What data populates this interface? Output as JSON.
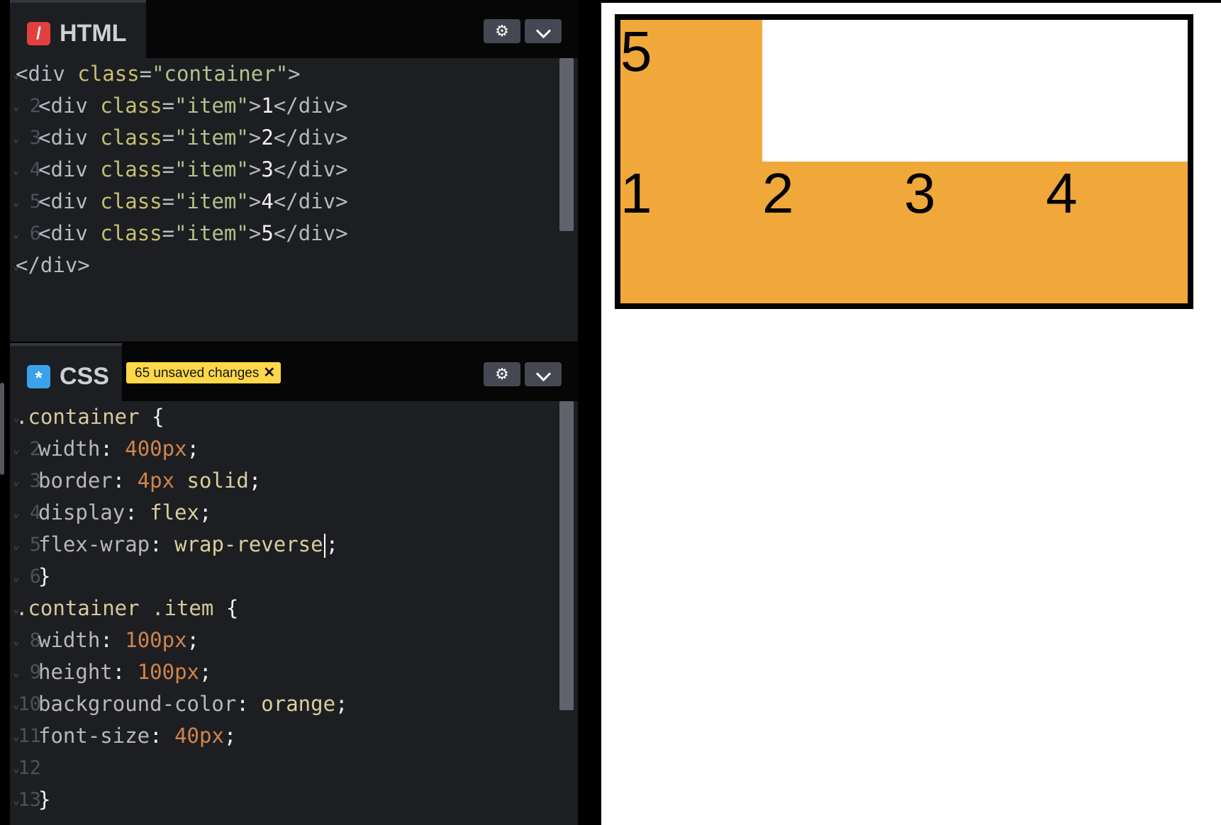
{
  "html_pane": {
    "title": "HTML",
    "icon": "slash-icon",
    "lines": [
      {
        "n": "",
        "parts": [
          [
            "tag",
            "<div "
          ],
          [
            "attr",
            "class"
          ],
          [
            "tag",
            "="
          ],
          [
            "str",
            "\"container\""
          ],
          [
            "tag",
            ">"
          ]
        ]
      },
      {
        "n": "2",
        "parts": [
          [
            "tag",
            "<div "
          ],
          [
            "attr",
            "class"
          ],
          [
            "tag",
            "="
          ],
          [
            "str",
            "\"item\""
          ],
          [
            "tag",
            ">"
          ],
          [
            "plain",
            "1"
          ],
          [
            "tag",
            "</div>"
          ]
        ]
      },
      {
        "n": "3",
        "parts": [
          [
            "tag",
            "<div "
          ],
          [
            "attr",
            "class"
          ],
          [
            "tag",
            "="
          ],
          [
            "str",
            "\"item\""
          ],
          [
            "tag",
            ">"
          ],
          [
            "plain",
            "2"
          ],
          [
            "tag",
            "</div>"
          ]
        ]
      },
      {
        "n": "4",
        "parts": [
          [
            "tag",
            "<div "
          ],
          [
            "attr",
            "class"
          ],
          [
            "tag",
            "="
          ],
          [
            "str",
            "\"item\""
          ],
          [
            "tag",
            ">"
          ],
          [
            "plain",
            "3"
          ],
          [
            "tag",
            "</div>"
          ]
        ]
      },
      {
        "n": "5",
        "parts": [
          [
            "tag",
            "<div "
          ],
          [
            "attr",
            "class"
          ],
          [
            "tag",
            "="
          ],
          [
            "str",
            "\"item\""
          ],
          [
            "tag",
            ">"
          ],
          [
            "plain",
            "4"
          ],
          [
            "tag",
            "</div>"
          ]
        ]
      },
      {
        "n": "6",
        "parts": [
          [
            "tag",
            "<div "
          ],
          [
            "attr",
            "class"
          ],
          [
            "tag",
            "="
          ],
          [
            "str",
            "\"item\""
          ],
          [
            "tag",
            ">"
          ],
          [
            "plain",
            "5"
          ],
          [
            "tag",
            "</div>"
          ]
        ]
      },
      {
        "n": "",
        "parts": [
          [
            "tag",
            "</div>"
          ]
        ]
      }
    ]
  },
  "css_pane": {
    "title": "CSS",
    "icon": "asterisk-icon",
    "unsaved_label": "65 unsaved changes",
    "lines": [
      {
        "n": "",
        "parts": [
          [
            "sel",
            ".container "
          ],
          [
            "plain",
            "{"
          ]
        ]
      },
      {
        "n": "2",
        "parts": [
          [
            "prop",
            "width"
          ],
          [
            "plain",
            ": "
          ],
          [
            "num",
            "400px"
          ],
          [
            "plain",
            ";"
          ]
        ]
      },
      {
        "n": "3",
        "parts": [
          [
            "prop",
            "border"
          ],
          [
            "plain",
            ": "
          ],
          [
            "num",
            "4px"
          ],
          [
            "kw",
            " solid"
          ],
          [
            "plain",
            ";"
          ]
        ]
      },
      {
        "n": "4",
        "parts": [
          [
            "prop",
            "display"
          ],
          [
            "plain",
            ": "
          ],
          [
            "kw",
            "flex"
          ],
          [
            "plain",
            ";"
          ]
        ]
      },
      {
        "n": "5",
        "parts": [
          [
            "prop",
            "flex-wrap"
          ],
          [
            "plain",
            ": "
          ],
          [
            "kw",
            "wrap-reverse"
          ],
          [
            "cursor",
            ""
          ],
          [
            "plain",
            ";"
          ]
        ]
      },
      {
        "n": "6",
        "parts": [
          [
            "plain",
            "} "
          ]
        ]
      },
      {
        "n": "",
        "parts": [
          [
            "sel",
            ".container .item "
          ],
          [
            "plain",
            "{"
          ]
        ]
      },
      {
        "n": "8",
        "parts": [
          [
            "prop",
            "width"
          ],
          [
            "plain",
            ": "
          ],
          [
            "num",
            "100px"
          ],
          [
            "plain",
            ";"
          ]
        ]
      },
      {
        "n": "9",
        "parts": [
          [
            "prop",
            "height"
          ],
          [
            "plain",
            ": "
          ],
          [
            "num",
            "100px"
          ],
          [
            "plain",
            ";"
          ]
        ]
      },
      {
        "n": "10",
        "parts": [
          [
            "prop",
            "background-color"
          ],
          [
            "plain",
            ": "
          ],
          [
            "kw",
            "orange"
          ],
          [
            "plain",
            ";"
          ]
        ]
      },
      {
        "n": "11",
        "parts": [
          [
            "prop",
            "font-size"
          ],
          [
            "plain",
            ": "
          ],
          [
            "num",
            "40px"
          ],
          [
            "plain",
            ";"
          ]
        ]
      },
      {
        "n": "12",
        "parts": []
      },
      {
        "n": "13",
        "parts": [
          [
            "plain",
            "}"
          ]
        ]
      }
    ]
  },
  "preview": {
    "items_bottom_row": [
      "1",
      "2",
      "3",
      "4"
    ],
    "items_top_row": [
      "5"
    ],
    "item_color": "#f0a83a"
  }
}
